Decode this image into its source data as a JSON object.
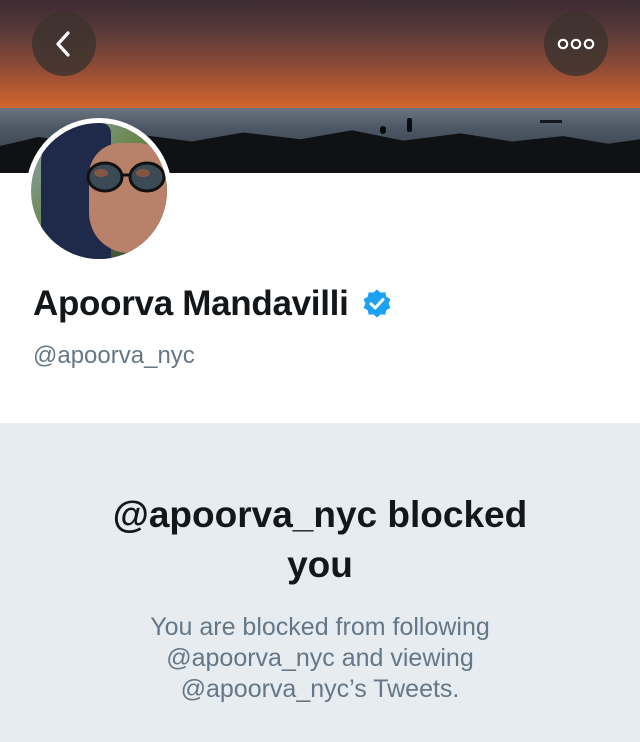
{
  "profile": {
    "name": "Apoorva Mandavilli",
    "handle": "@apoorva_nyc",
    "verified": true
  },
  "icons": {
    "back": "chevron-left-icon",
    "more": "more-options-icon",
    "verified": "verified-badge-icon"
  },
  "blocked": {
    "title_line1": "@apoorva_nyc blocked",
    "title_line2": "you",
    "desc_line1": "You are blocked from following",
    "desc_line2": "@apoorva_nyc and viewing",
    "desc_line3": "@apoorva_nyc’s Tweets."
  },
  "colors": {
    "accent": "#1da1f2",
    "text_primary": "#14171a",
    "text_secondary": "#657786",
    "panel_bg": "#e6ecf0"
  }
}
